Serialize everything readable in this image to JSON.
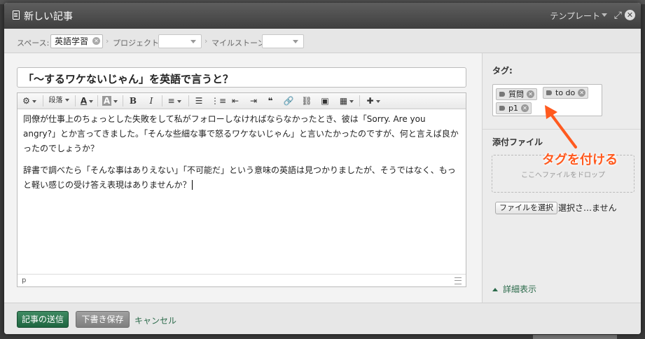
{
  "dialog": {
    "title": "新しい記事",
    "template_label": "テンプレート"
  },
  "breadcrumbs": {
    "space_label": "スペース:",
    "space_value": "英語学習",
    "project_label": "プロジェクト",
    "milestone_label": "マイルストーン",
    "separator": "›"
  },
  "editor": {
    "subject": "「〜するワケないじゃん」を英語で言うと？",
    "toolbar": {
      "paragraph_label": "段落",
      "bold_label": "B",
      "italic_label": "I",
      "text_color_label": "A",
      "bg_color_label": "A"
    },
    "paragraphs": [
      "同僚が仕事上のちょっとした失敗をして私がフォローしなければならなかったとき、彼は「Sorry. Are you angry?」とか言ってきました。「そんな些細な事で怒るワケないじゃん」と言いたかったのですが、何と言えば良かったのでしょうか？",
      "辞書で調べたら「そんな事はありえない」「不可能だ」という意味の英語は見つかりましたが、そうではなく、もっと軽い感じの受け答え表現はありませんか？"
    ],
    "status_path": "p"
  },
  "sidebar": {
    "tags_heading": "タグ:",
    "tags": [
      "質問",
      "to do",
      "p1"
    ],
    "attachments_heading": "添付ファイル",
    "dropzone_text": "ここへファイルをドロップ",
    "file_button": "ファイルを選択",
    "file_status": "選択さ…ません",
    "detail_link": "詳細表示"
  },
  "annotation": {
    "text": "タグを付ける",
    "color": "#ff5a1f"
  },
  "footer": {
    "send_button": "記事の送信",
    "draft_button": "下書き保存",
    "cancel_link": "キャンセル"
  },
  "colors": {
    "primary_green": "#1f6540",
    "link_green": "#2b6a4a"
  }
}
